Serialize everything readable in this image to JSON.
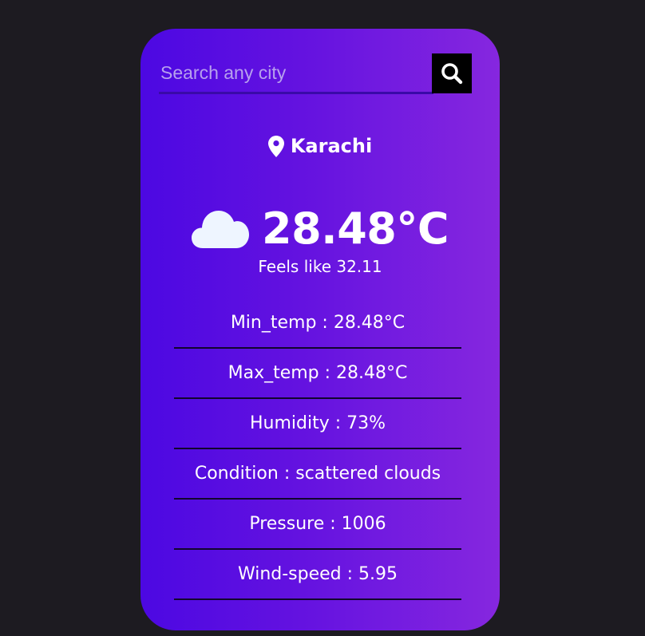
{
  "search": {
    "placeholder": "Search any city",
    "value": "",
    "button_icon": "search-icon"
  },
  "location": {
    "icon": "map-pin-icon",
    "city": "Karachi"
  },
  "current": {
    "icon": "cloud-icon",
    "temperature": "28.48°C",
    "feels_like": "Feels like 32.11"
  },
  "details": {
    "min_temp": "Min_temp : 28.48°C",
    "max_temp": "Max_temp : 28.48°C",
    "humidity": "Humidity : 73%",
    "condition": "Condition : scattered clouds",
    "pressure": "Pressure : 1006",
    "wind_speed": "Wind-speed : 5.95"
  },
  "colors": {
    "background": "#1d1b21",
    "card_gradient_start": "#4c08e2",
    "card_gradient_end": "#8627df",
    "cloud": "#eef5ff",
    "divider": "#12062e"
  }
}
